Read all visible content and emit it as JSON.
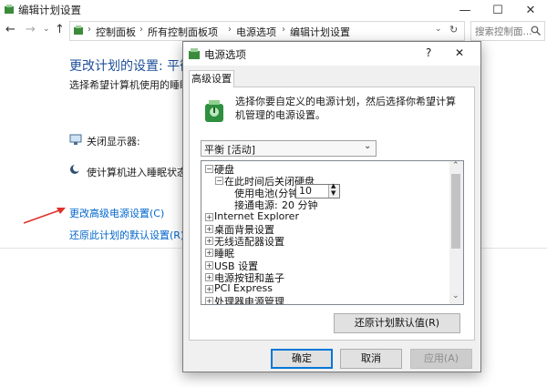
{
  "window": {
    "title": "编辑计划设置"
  },
  "nav": {
    "breadcrumb": [
      "控制面板",
      "所有控制面板项",
      "电源选项",
      "编辑计划设置"
    ],
    "search_placeholder": "搜索控制面..."
  },
  "main": {
    "heading": "更改计划的设置: 平衡",
    "subheading": "选择希望计算机使用的睡眠",
    "display_off_label": "关闭显示器:",
    "sleep_label": "使计算机进入睡眠状态:",
    "advanced_link": "更改高级电源设置(C)",
    "restore_link": "还原此计划的默认设置(R)"
  },
  "dialog": {
    "title": "电源选项",
    "help": "?",
    "tab": "高级设置",
    "description": "选择你要自定义的电源计划，然后选择你希望计算机管理的电源设置。",
    "plan_selected": "平衡 [活动]",
    "tree": {
      "harddisk": "硬盘",
      "turn_off_after": "在此时间后关闭硬盘",
      "on_battery_label": "使用电池(分钟):",
      "on_battery_value": "10",
      "plugged_in_label": "接通电源:",
      "plugged_in_value": "20 分钟",
      "items": [
        "Internet Explorer",
        "桌面背景设置",
        "无线适配器设置",
        "睡眠",
        "USB 设置",
        "电源按钮和盖子",
        "PCI Express",
        "处理器电源管理"
      ]
    },
    "restore_defaults": "还原计划默认值(R)",
    "ok": "确定",
    "cancel": "取消",
    "apply": "应用(A)"
  },
  "colors": {
    "link": "#0066cc",
    "heading": "#1e4f9a",
    "arrow": "#e0312b",
    "focus": "#0078d7"
  }
}
